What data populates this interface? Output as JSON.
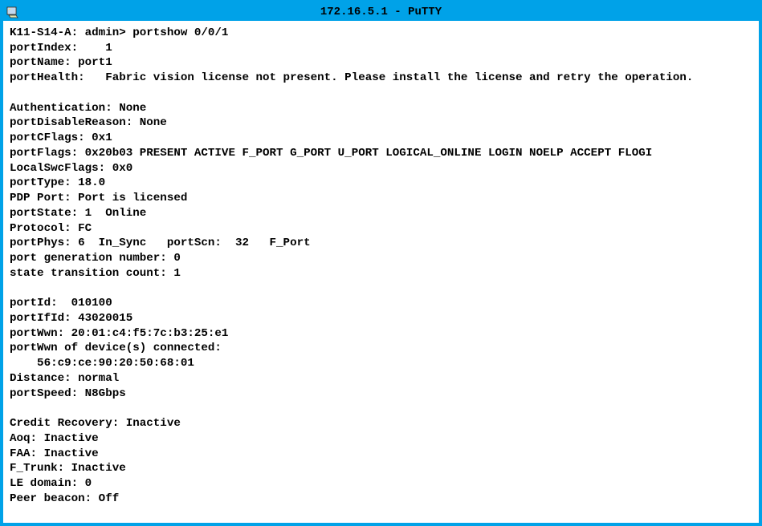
{
  "window": {
    "title": "172.16.5.1 - PuTTY"
  },
  "terminal": {
    "lines": [
      "K11-S14-A: admin> portshow 0/0/1",
      "portIndex:    1",
      "portName: port1",
      "portHealth:   Fabric vision license not present. Please install the license and retry the operation.",
      "",
      "Authentication: None",
      "portDisableReason: None",
      "portCFlags: 0x1",
      "portFlags: 0x20b03 PRESENT ACTIVE F_PORT G_PORT U_PORT LOGICAL_ONLINE LOGIN NOELP ACCEPT FLOGI",
      "LocalSwcFlags: 0x0",
      "portType: 18.0",
      "PDP Port: Port is licensed",
      "portState: 1  Online",
      "Protocol: FC",
      "portPhys: 6  In_Sync   portScn:  32   F_Port",
      "port generation number: 0",
      "state transition count: 1",
      "",
      "portId:  010100",
      "portIfId: 43020015",
      "portWwn: 20:01:c4:f5:7c:b3:25:e1",
      "portWwn of device(s) connected:",
      "    56:c9:ce:90:20:50:68:01",
      "Distance: normal",
      "portSpeed: N8Gbps",
      "",
      "Credit Recovery: Inactive",
      "Aoq: Inactive",
      "FAA: Inactive",
      "F_Trunk: Inactive",
      "LE domain: 0",
      "Peer beacon: Off"
    ]
  }
}
